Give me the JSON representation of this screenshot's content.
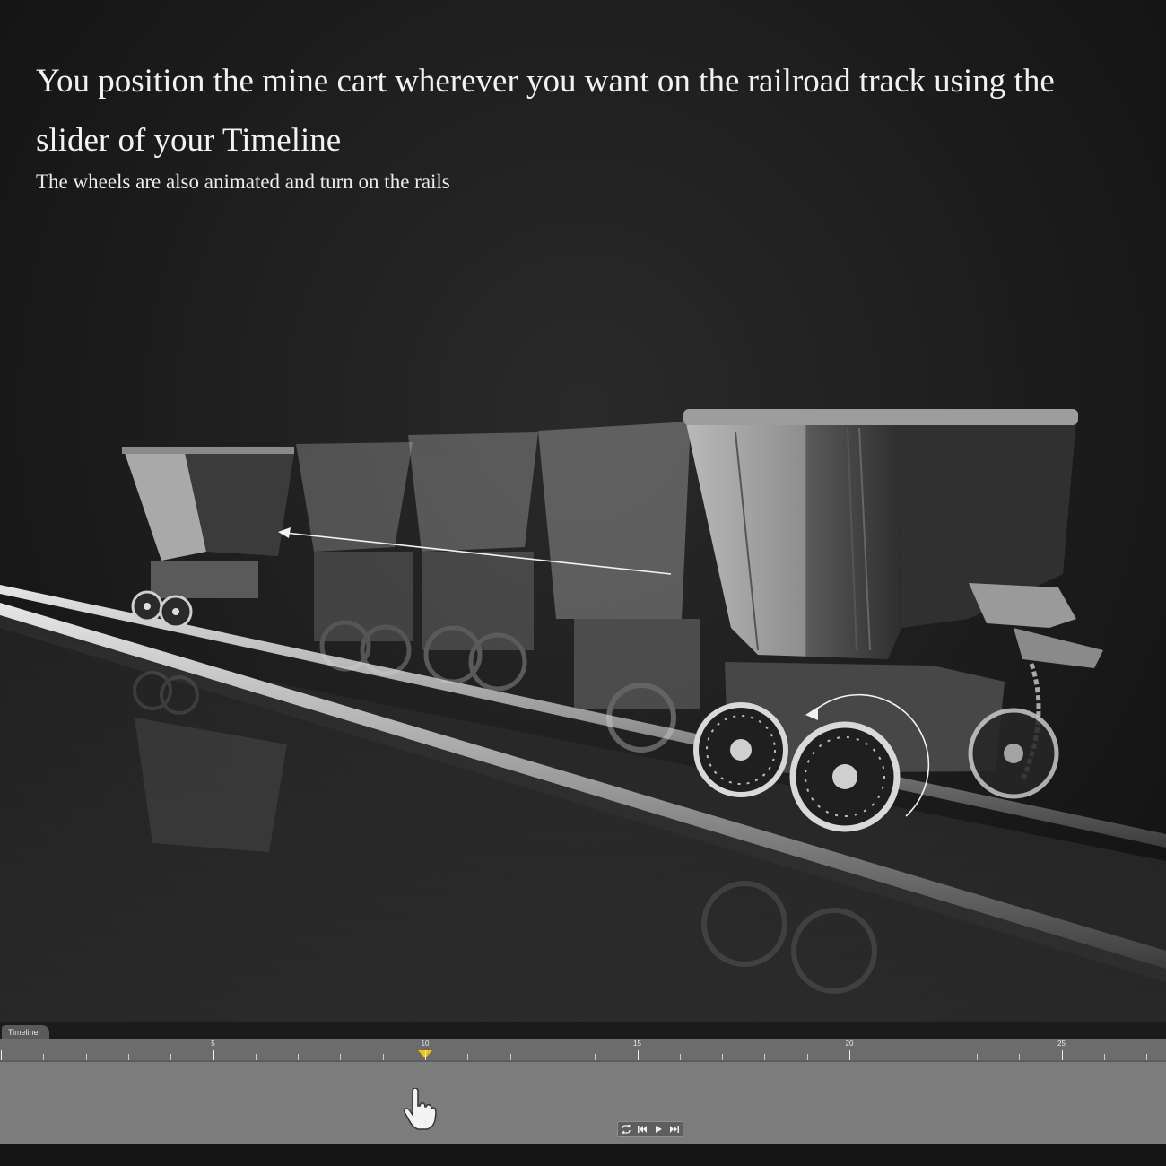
{
  "headline": "You position the mine cart wherever you want on the railroad track using the slider of your Timeline",
  "subline": "The wheels are also animated and turn on the rails",
  "timeline": {
    "tab_label": "Timeline",
    "frame_start": 0,
    "frame_end": 27,
    "major_labels": [
      "5",
      "10",
      "15",
      "20",
      "25"
    ],
    "current_frame": 10,
    "playhead_color": "#f3c200",
    "transport_buttons": [
      "loop-icon",
      "go-to-start-icon",
      "play-icon",
      "go-to-end-icon"
    ]
  }
}
